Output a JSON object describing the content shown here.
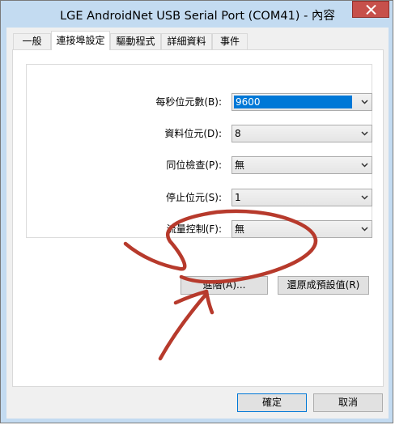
{
  "window": {
    "title": "LGE AndroidNet USB Serial Port (COM41) - 內容"
  },
  "tabs": [
    {
      "label": "一般",
      "active": false
    },
    {
      "label": "連接埠設定",
      "active": true
    },
    {
      "label": "驅動程式",
      "active": false
    },
    {
      "label": "詳細資料",
      "active": false
    },
    {
      "label": "事件",
      "active": false
    }
  ],
  "port_settings": {
    "bits_per_second": {
      "label": "每秒位元數(B):",
      "value": "9600"
    },
    "data_bits": {
      "label": "資料位元(D):",
      "value": "8"
    },
    "parity": {
      "label": "同位檢查(P):",
      "value": "無"
    },
    "stop_bits": {
      "label": "停止位元(S):",
      "value": "1"
    },
    "flow_control": {
      "label": "流量控制(F):",
      "value": "無"
    }
  },
  "buttons": {
    "advanced": "進階(A)...",
    "restore_defaults": "還原成預設值(R)",
    "ok": "確定",
    "cancel": "取消"
  },
  "annotation": {
    "color": "#b73a2c"
  }
}
